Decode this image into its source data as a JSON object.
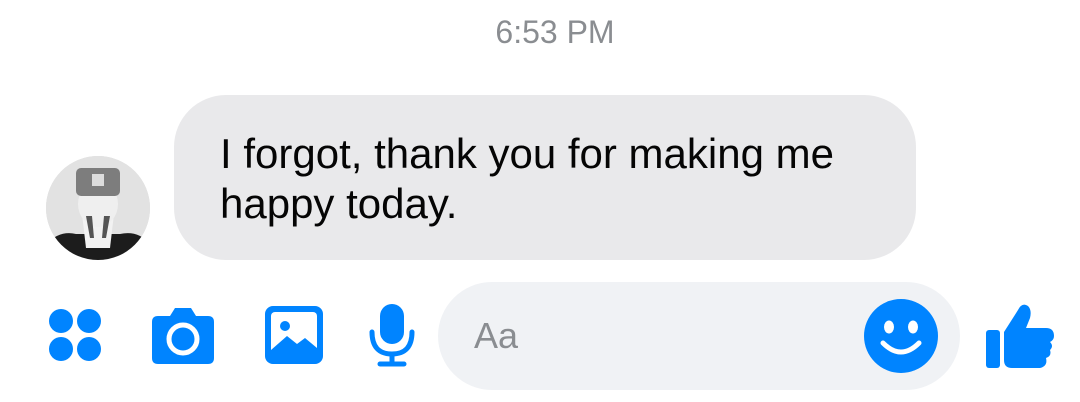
{
  "conversation": {
    "timestamp": "6:53 PM",
    "messages": [
      {
        "sender": "other",
        "avatar_icon": "contact-avatar",
        "text": "I forgot, thank you for making me happy today."
      }
    ]
  },
  "composer": {
    "placeholder": "Aa",
    "value": "",
    "icons": [
      "more-actions-icon",
      "camera-icon",
      "gallery-icon",
      "microphone-icon",
      "emoji-icon",
      "thumbs-up-icon"
    ]
  },
  "colors": {
    "accent": "#0084ff",
    "bubble_received": "#e9e9eb",
    "input_background": "#f0f2f5",
    "timestamp_text": "#8a8d91"
  }
}
